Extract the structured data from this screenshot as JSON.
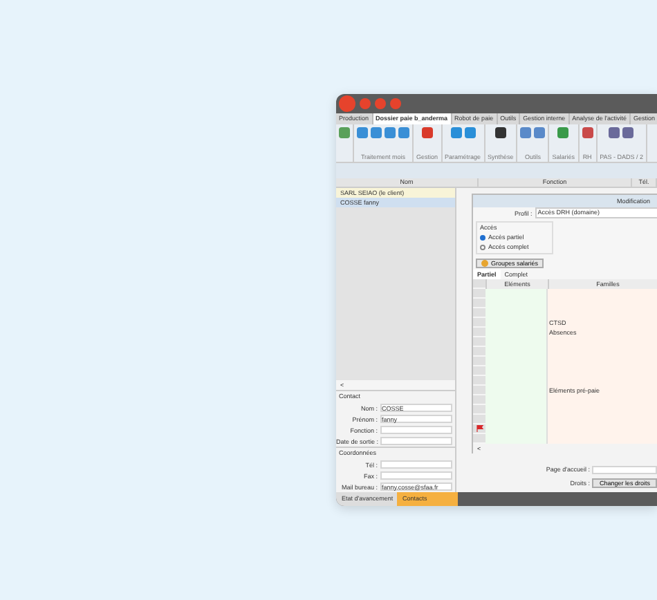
{
  "window": {
    "tabs": [
      {
        "label": "Production",
        "selected": false
      },
      {
        "label": "Dossier paie b_anderma",
        "selected": true
      },
      {
        "label": "Robot de paie",
        "selected": false
      },
      {
        "label": "Outils",
        "selected": false
      },
      {
        "label": "Gestion interne",
        "selected": false
      },
      {
        "label": "Analyse de l'activité",
        "selected": false
      },
      {
        "label": "Gestion",
        "selected": false
      }
    ],
    "toolbar_groups": [
      {
        "label": "Traitement mois"
      },
      {
        "label": "Gestion"
      },
      {
        "label": "Paramétrage"
      },
      {
        "label": "Synthèse"
      },
      {
        "label": "Outils"
      },
      {
        "label": "Salariés"
      },
      {
        "label": "RH"
      },
      {
        "label": "PAS - DADS / 2"
      }
    ]
  },
  "table": {
    "columns": [
      "Nom",
      "Fonction",
      "Tél."
    ],
    "rows": [
      {
        "name": "SARL SEIAO (le client)",
        "kind": "client",
        "selected": false
      },
      {
        "name": "COSSE fanny",
        "kind": "contact",
        "selected": true
      }
    ]
  },
  "contact": {
    "title": "Contact",
    "fields": [
      {
        "label": "Nom :",
        "value": "COSSE"
      },
      {
        "label": "Prénom :",
        "value": "fanny"
      },
      {
        "label": "Fonction :"
      },
      {
        "label": "Date de sortie :"
      }
    ]
  },
  "coordinates": {
    "title": "Coordonnées",
    "fields": [
      {
        "label": "Tél :"
      },
      {
        "label": "Fax :"
      },
      {
        "label": "Mail bureau :",
        "value": "fanny.cosse@sfaa.fr"
      }
    ]
  },
  "right_fields": {
    "home_label": "Page d'accueil :",
    "rights_label": "Droits :",
    "rights_button": "Changer les droits"
  },
  "dialog": {
    "title": "Modification",
    "profile_label": "Profil :",
    "profile_value": "Accès DRH (domaine)",
    "access_title": "Accès",
    "access_options": [
      {
        "label": "Accès partiel",
        "selected": true
      },
      {
        "label": "Accès complet",
        "selected": false
      }
    ],
    "groups_button": "Groupes salariés",
    "tabs": [
      {
        "label": "Partiel",
        "selected": true
      },
      {
        "label": "Complet",
        "selected": false
      }
    ],
    "columns": [
      "Eléments",
      "Familles"
    ],
    "rows": [
      {
        "flagged": false
      },
      {
        "flagged": false
      },
      {
        "flagged": false
      },
      {
        "famille": "CTSD",
        "flagged": false
      },
      {
        "famille": "Absences",
        "flagged": false
      },
      {
        "flagged": false
      },
      {
        "flagged": false
      },
      {
        "flagged": false
      },
      {
        "flagged": false
      },
      {
        "flagged": false
      },
      {
        "famille": "Eléments pré-paie",
        "flagged": false
      },
      {
        "flagged": false
      },
      {
        "flagged": false
      },
      {
        "flagged": false
      },
      {
        "flagged": true
      },
      {
        "flagged": false
      }
    ],
    "scroll_arrow": "<"
  },
  "left_scroll_arrow": "<",
  "status_tabs": [
    {
      "label": "Etat d'avancement",
      "selected": false
    },
    {
      "label": "Contacts",
      "selected": true
    }
  ]
}
